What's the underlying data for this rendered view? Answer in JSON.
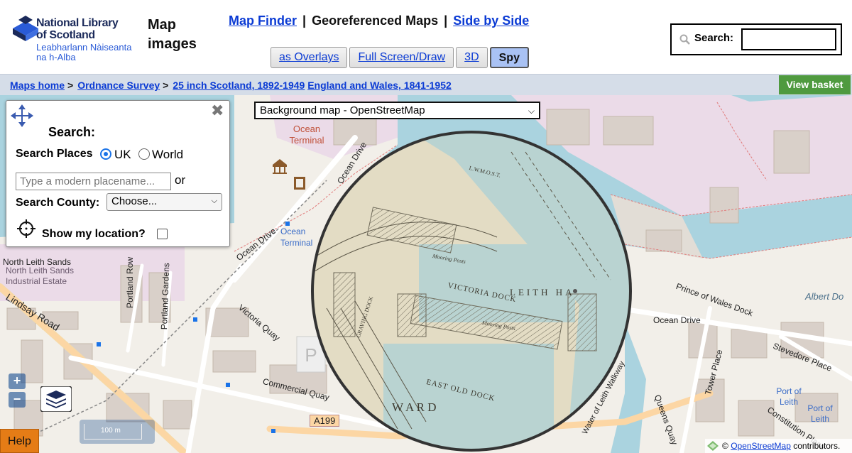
{
  "header": {
    "logo_name": "National Library of Scotland",
    "logo_gaelic": "Leabharlann Nàiseanta na h-Alba",
    "app_title": "Map images"
  },
  "topnav": {
    "map_finder": "Map Finder",
    "georeferenced": "Georeferenced Maps",
    "side_by_side": "Side by Side",
    "separator": "|"
  },
  "viewtabs": [
    "as Overlays",
    "Full Screen/Draw",
    "3D",
    "Spy"
  ],
  "search": {
    "label": "Search:",
    "value": ""
  },
  "breadcrumb": {
    "items": [
      "Maps home",
      "Ordnance Survey",
      "25 inch Scotland, 1892-1949",
      "England and Wales, 1841-1952"
    ],
    "separator": ">"
  },
  "basket_label": "View basket",
  "bg_select": "Background map - OpenStreetMap",
  "search_panel": {
    "title": "Search:",
    "places_label": "Search Places",
    "radio_uk": "UK",
    "radio_world": "World",
    "selected": "UK",
    "place_placeholder": "Type a modern placename...",
    "or": "or",
    "county_label": "Search County:",
    "county_value": "Choose...",
    "location_label": "Show my location?",
    "location_checked": false
  },
  "map_labels": {
    "ocean_terminal": "Ocean Terminal",
    "ocean_terminal_stop": "Ocean Terminal",
    "ocean_drive": "Ocean Drive",
    "north_leith_sands": "North Leith Sands",
    "industrial_estate": "North Leith Sands Industrial Estate",
    "portland_row": "Portland Row",
    "portland_gardens": "Portland Gardens",
    "lindsay_road": "Lindsay Road",
    "victoria_quay": "Victoria Quay",
    "commercial_quay": "Commercial Quay",
    "a199": "A199",
    "prince_of_wales_dock": "Prince of Wales Dock",
    "albert_dock": "Albert Do",
    "stevedore_place": "Stevedore Place",
    "queens_quay": "Queens Quay",
    "tower_place": "Tower Place",
    "port_of_leith": "Port of Leith",
    "constitution_place": "Constitution Place",
    "water_of_leith": "Water of Leith Walkway",
    "old_victoria_dock": "VICTORIA DOCK",
    "old_leith_harbour": "LEITH HA",
    "old_east_dock": "EAST OLD DOCK",
    "old_ward": "W A R D",
    "old_mooring_posts": "Mooring Posts",
    "old_graving_dock": "GRAVING DOCK",
    "old_lwmost": "L.W.M.O.S.T."
  },
  "zoom": {
    "in": "+",
    "out": "−"
  },
  "scale_label": "100 m",
  "help_label": "Help",
  "attribution": {
    "prefix": "©",
    "link": "OpenStreetMap",
    "suffix": "contributors."
  }
}
